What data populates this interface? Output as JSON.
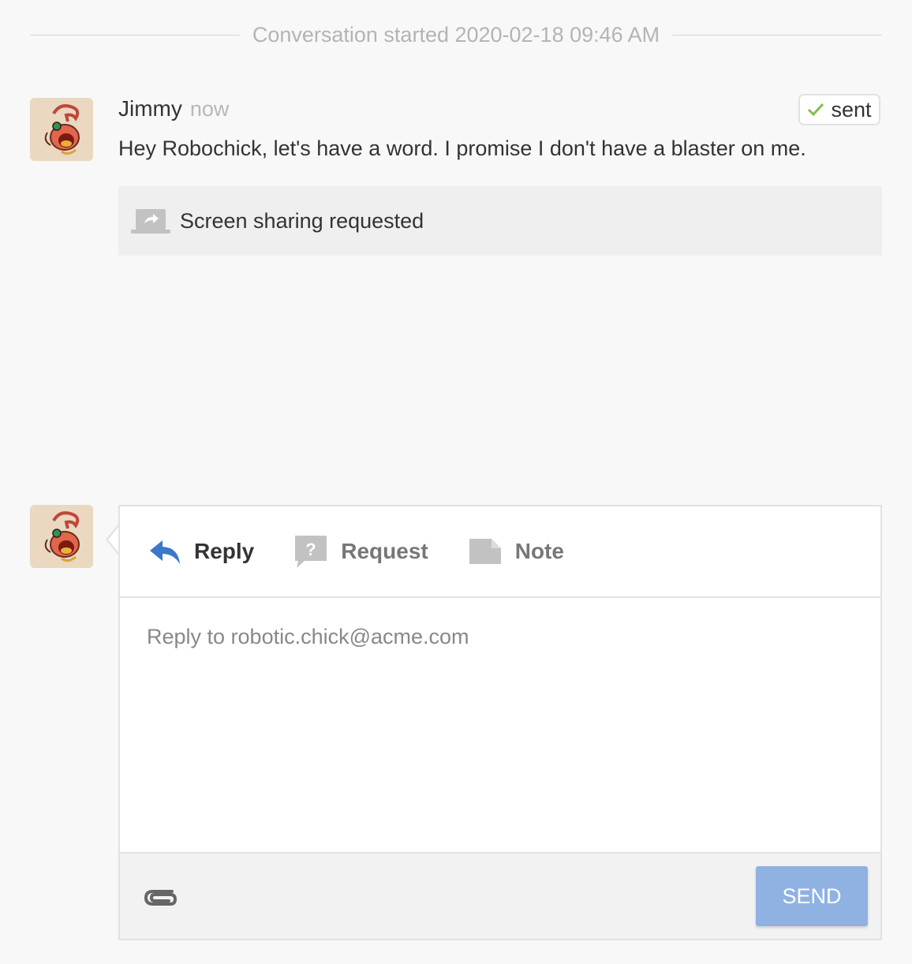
{
  "conversation": {
    "started_label": "Conversation started 2020-02-18 09:46 AM"
  },
  "message": {
    "author": "Jimmy",
    "time": "now",
    "status": "sent",
    "body": "Hey Robochick, let's have a word. I promise I don't have a blaster on me.",
    "event_text": "Screen sharing requested"
  },
  "composer": {
    "tabs": [
      {
        "label": "Reply",
        "icon": "reply-arrow-icon",
        "active": true
      },
      {
        "label": "Request",
        "icon": "question-bubble-icon",
        "active": false
      },
      {
        "label": "Note",
        "icon": "note-icon",
        "active": false
      }
    ],
    "placeholder": "Reply to robotic.chick@acme.com",
    "send_label": "SEND",
    "attach_icon": "paperclip-icon"
  },
  "colors": {
    "accent": "#3a78c9",
    "send_button": "#8fb2e3",
    "check": "#7cc24a"
  }
}
